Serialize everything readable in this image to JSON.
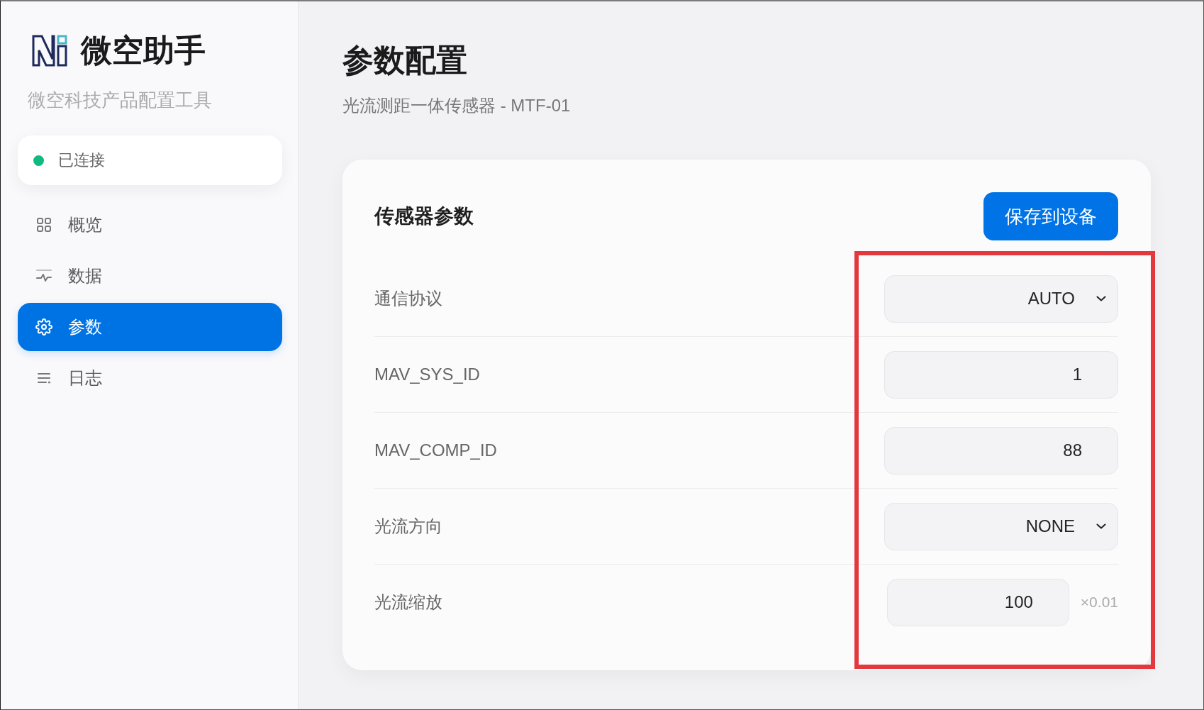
{
  "sidebar": {
    "app_title": "微空助手",
    "app_subtitle": "微空科技产品配置工具",
    "connection": {
      "label": "已连接",
      "connected": true
    },
    "nav_items": [
      {
        "label": "概览",
        "selected": false
      },
      {
        "label": "数据",
        "selected": false
      },
      {
        "label": "参数",
        "selected": true
      },
      {
        "label": "日志",
        "selected": false
      }
    ]
  },
  "header": {
    "title": "参数配置",
    "subtitle": "光流测距一体传感器 - MTF-01"
  },
  "card": {
    "title": "传感器参数",
    "save_button": "保存到设备",
    "params": [
      {
        "label": "通信协议",
        "kind": "select",
        "value": "AUTO"
      },
      {
        "label": "MAV_SYS_ID",
        "kind": "number",
        "value": "1"
      },
      {
        "label": "MAV_COMP_ID",
        "kind": "number",
        "value": "88"
      },
      {
        "label": "光流方向",
        "kind": "select",
        "value": "NONE"
      },
      {
        "label": "光流缩放",
        "kind": "number",
        "value": "100",
        "unit": "×0.01"
      }
    ]
  },
  "annotations": [
    {
      "kind": "rectangle"
    }
  ]
}
